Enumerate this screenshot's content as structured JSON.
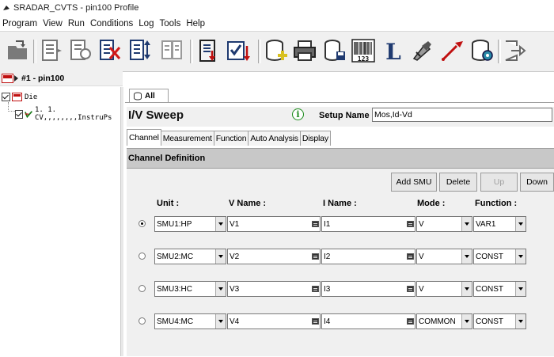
{
  "window": {
    "title": "SRADAR_CVTS - pin100 Profile"
  },
  "menu": [
    "Program",
    "View",
    "Run",
    "Conditions",
    "Log",
    "Tools",
    "Help"
  ],
  "toolbar": {
    "buttons": [
      {
        "name": "open-folder-icon"
      },
      {
        "name": "list-doc-icon"
      },
      {
        "name": "copy-doc-icon"
      },
      {
        "name": "delete-list-icon"
      },
      {
        "name": "sort-list-icon"
      },
      {
        "name": "compare-icon"
      },
      {
        "name": "export-list-icon"
      },
      {
        "name": "checklist-icon"
      },
      {
        "name": "database-add-icon"
      },
      {
        "name": "printer-icon"
      },
      {
        "name": "database-save-icon"
      },
      {
        "name": "barcode-icon"
      },
      {
        "name": "letter-l-icon"
      },
      {
        "name": "tools-icon"
      },
      {
        "name": "probe-icon"
      },
      {
        "name": "database-gear-icon"
      },
      {
        "name": "exit-icon"
      }
    ],
    "barcode_text": "123",
    "l_text": "L"
  },
  "tree": {
    "header_label": "#1 - pin100",
    "die_label": "Die",
    "child_label": "1. 1. CV,,,,,,,,InstruPs"
  },
  "tabs": {
    "all_label": "All"
  },
  "sweep": {
    "title": "I/V Sweep",
    "info_glyph": "i",
    "setup_label": "Setup Name :",
    "setup_value": "Mos,Id-Vd"
  },
  "subtabs": [
    "Channel",
    "Measurement",
    "Function",
    "Auto Analysis",
    "Display"
  ],
  "channel_def": {
    "title": "Channel Definition",
    "buttons": {
      "add": "Add SMU",
      "delete": "Delete",
      "up": "Up",
      "down": "Down"
    },
    "headers": {
      "unit": "Unit :",
      "vname": "V Name :",
      "iname": "I Name :",
      "mode": "Mode :",
      "function": "Function :"
    },
    "rows": [
      {
        "unit": "SMU1:HP",
        "vname": "V1",
        "iname": "I1",
        "mode": "V",
        "function": "VAR1"
      },
      {
        "unit": "SMU2:MC",
        "vname": "V2",
        "iname": "I2",
        "mode": "V",
        "function": "CONST"
      },
      {
        "unit": "SMU3:HC",
        "vname": "V3",
        "iname": "I3",
        "mode": "V",
        "function": "CONST"
      },
      {
        "unit": "SMU4:MC",
        "vname": "V4",
        "iname": "I4",
        "mode": "COMMON",
        "function": "CONST"
      }
    ],
    "selected_row": 0
  }
}
